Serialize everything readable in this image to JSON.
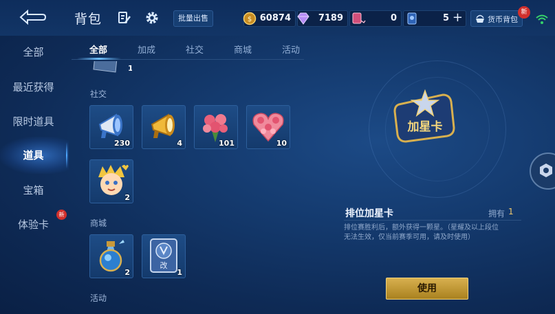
{
  "header": {
    "title": "背包",
    "batch_sell": "批量出售",
    "currencies": [
      {
        "icon": "gold-coin-icon",
        "value": "60874"
      },
      {
        "icon": "diamond-icon",
        "value": "7189"
      },
      {
        "icon": "coupon-icon",
        "value": "0"
      },
      {
        "icon": "pass-card-icon",
        "value": "5"
      }
    ],
    "wallet_label": "货币背包",
    "new_badge": "新"
  },
  "sidebar": {
    "items": [
      {
        "label": "全部"
      },
      {
        "label": "最近获得"
      },
      {
        "label": "限时道具"
      },
      {
        "label": "道具"
      },
      {
        "label": "宝箱"
      },
      {
        "label": "体验卡",
        "badge": "新"
      }
    ],
    "active": "道具"
  },
  "tabs": [
    "全部",
    "加成",
    "社交",
    "商城",
    "活动"
  ],
  "list": {
    "top_partial_count": "1",
    "sections": [
      {
        "title": "社交",
        "items": [
          {
            "icon": "megaphone-blue-icon",
            "count": "230"
          },
          {
            "icon": "megaphone-gold-icon",
            "count": "4"
          },
          {
            "icon": "rose-bouquet-icon",
            "count": "101"
          },
          {
            "icon": "rose-heart-icon",
            "count": "10"
          },
          {
            "icon": "hero-sticker-icon",
            "count": "2"
          }
        ]
      },
      {
        "title": "商城",
        "items": [
          {
            "icon": "potion-bottle-icon",
            "count": "2"
          },
          {
            "icon": "rename-card-icon",
            "count": "1"
          }
        ]
      },
      {
        "title": "活动",
        "items": []
      }
    ]
  },
  "detail": {
    "card_text": "加星卡",
    "name": "排位加星卡",
    "own_label": "拥有",
    "own_value": "1",
    "description": "排位赛胜利后，额外获得一颗星。（星耀及以上段位无法生效，仅当前赛季可用，请及时使用）",
    "use_button": "使用"
  },
  "colors": {
    "accent_gold": "#d8b04f",
    "panel_blue": "#143a6e",
    "badge_red": "#d1302c"
  }
}
